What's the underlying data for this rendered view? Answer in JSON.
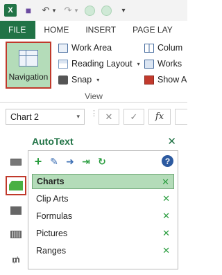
{
  "titlebar": {
    "logo_text": "X",
    "undo_glyph": "↶",
    "redo_glyph": "↷",
    "save_glyph": "■",
    "dropdown_glyph": "▾"
  },
  "tabs": [
    {
      "label": "FILE"
    },
    {
      "label": "HOME"
    },
    {
      "label": "INSERT"
    },
    {
      "label": "PAGE LAY"
    }
  ],
  "ribbon": {
    "navigation_label": "Navigation",
    "work_area": "Work Area",
    "reading_layout": "Reading Layout",
    "snap": "Snap",
    "columns": "Colum",
    "worksheets": "Works",
    "show": "Show A",
    "group_label": "View"
  },
  "formula_bar": {
    "name_box_value": "Chart 2",
    "cancel_glyph": "✕",
    "enter_glyph": "✓",
    "fx_label": "fx"
  },
  "pane": {
    "title": "AutoText",
    "close_glyph": "✕",
    "help_glyph": "?",
    "items": [
      {
        "label": "Charts",
        "selected": true
      },
      {
        "label": "Clip Arts",
        "selected": false
      },
      {
        "label": "Formulas",
        "selected": false
      },
      {
        "label": "Pictures",
        "selected": false
      },
      {
        "label": "Ranges",
        "selected": false
      }
    ]
  },
  "colors": {
    "excel_green": "#217346",
    "selection_fill": "#b4dcb9",
    "highlight_border": "#c0392b"
  }
}
